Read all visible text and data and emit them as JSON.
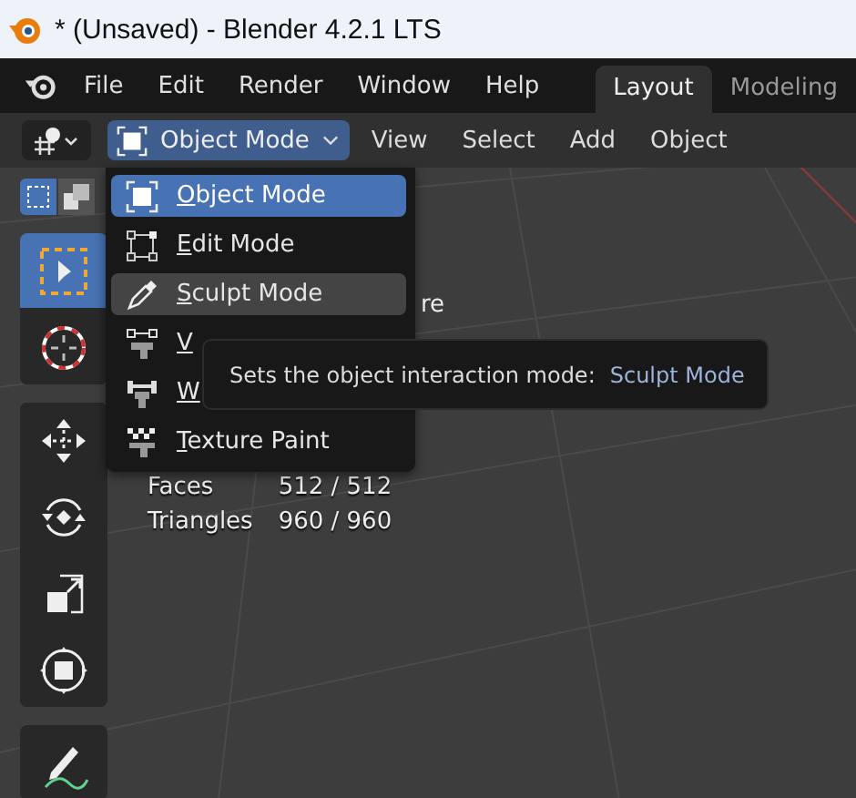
{
  "window": {
    "title": "* (Unsaved) - Blender 4.2.1 LTS"
  },
  "menu_bar": {
    "items": [
      "File",
      "Edit",
      "Render",
      "Window",
      "Help"
    ]
  },
  "workspace_tabs": [
    {
      "label": "Layout",
      "selected": true
    },
    {
      "label": "Modeling",
      "selected": false
    }
  ],
  "header": {
    "mode": "Object Mode",
    "menus": [
      "View",
      "Select",
      "Add",
      "Object"
    ]
  },
  "toolbar": {
    "select_modes": [
      {
        "selected": true
      },
      {
        "selected": false
      }
    ],
    "tools": [
      {
        "kind": "select",
        "selected": true
      },
      {
        "kind": "cursor",
        "selected": false
      },
      {
        "kind": "move",
        "selected": false
      },
      {
        "kind": "rotate",
        "selected": false
      },
      {
        "kind": "scale",
        "selected": false
      },
      {
        "kind": "transform",
        "selected": false
      },
      {
        "kind": "annotate",
        "selected": false
      }
    ]
  },
  "mode_menu": [
    {
      "label": "Object Mode",
      "kind": "object",
      "selected": true,
      "hovered": false
    },
    {
      "label": "Edit Mode",
      "kind": "edit",
      "selected": false,
      "hovered": false
    },
    {
      "label": "Sculpt Mode",
      "kind": "sculpt",
      "selected": false,
      "hovered": true
    },
    {
      "label": "V",
      "kind": "vertex",
      "selected": false,
      "hovered": false
    },
    {
      "label": "W",
      "kind": "weight",
      "selected": false,
      "hovered": false
    },
    {
      "label": "Texture Paint",
      "kind": "texture",
      "selected": false,
      "hovered": false
    }
  ],
  "tooltip": {
    "text": "Sets the object interaction mode:",
    "value": "Sculpt Mode"
  },
  "stats_fragment": "re",
  "stats": [
    {
      "label": "Faces",
      "value": "512 / 512"
    },
    {
      "label": "Triangles",
      "value": "960 / 960"
    }
  ]
}
